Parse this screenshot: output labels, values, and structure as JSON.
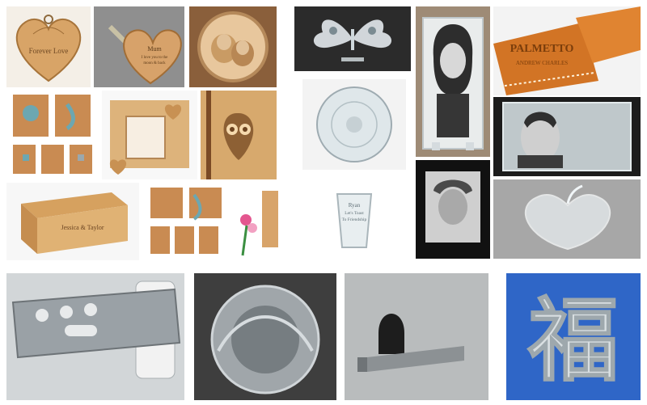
{
  "collage": {
    "tiles": [
      {
        "id": "heart-pendant-wood",
        "text": "Forever Love"
      },
      {
        "id": "heart-keychain-wood",
        "text_lines": [
          "Mum",
          "I love you to the",
          "moon & back"
        ]
      },
      {
        "id": "round-photo-engraved-wood"
      },
      {
        "id": "butterfly-acrylic"
      },
      {
        "id": "portrait-glass-girl"
      },
      {
        "id": "leather-keychains",
        "text_lines": [
          "PALMETTO",
          "ANDREW CHARLES"
        ]
      },
      {
        "id": "wood-notebooks-set"
      },
      {
        "id": "love-photo-frame-wood"
      },
      {
        "id": "owl-notebook-wood"
      },
      {
        "id": "round-engraved-glass"
      },
      {
        "id": "portrait-glass-man"
      },
      {
        "id": "wood-box-laser-cut",
        "text": "Jessica & Taylor"
      },
      {
        "id": "wood-notebooks-small"
      },
      {
        "id": "notebook-flowers"
      },
      {
        "id": "shot-glass-engraved",
        "text_lines": [
          "Ryan",
          "Let's Toast",
          "To Friendship"
        ]
      },
      {
        "id": "old-man-photo-engraved"
      },
      {
        "id": "acrylic-apple"
      },
      {
        "id": "metal-sheet-cut"
      },
      {
        "id": "metal-disc-pattern"
      },
      {
        "id": "metal-bracket-cut"
      },
      {
        "id": "metal-character-fu",
        "text": "福"
      }
    ],
    "colors": {
      "wood": "#d9a86b",
      "leather": "#d07a2e",
      "glass": "#dfe6ea",
      "metal": "#b9bec2",
      "blue_bg": "#2f66c7"
    }
  }
}
